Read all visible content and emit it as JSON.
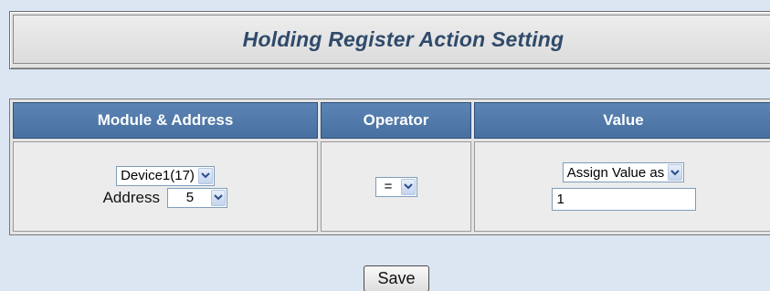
{
  "title": "Holding Register Action Setting",
  "table": {
    "headers": {
      "module_address": "Module & Address",
      "operator": "Operator",
      "value": "Value"
    },
    "row": {
      "device_select": "Device1(17)",
      "address_label": "Address",
      "address_select": "5",
      "operator_select": "=",
      "value_mode_select": "Assign Value as",
      "value_input": "1"
    }
  },
  "save_label": "Save",
  "colors": {
    "page_bg": "#dce6f3",
    "header_bg": "#5c84b4",
    "title_text": "#2f4a6a"
  },
  "icons": {
    "dropdown": "chevron-down-icon"
  }
}
